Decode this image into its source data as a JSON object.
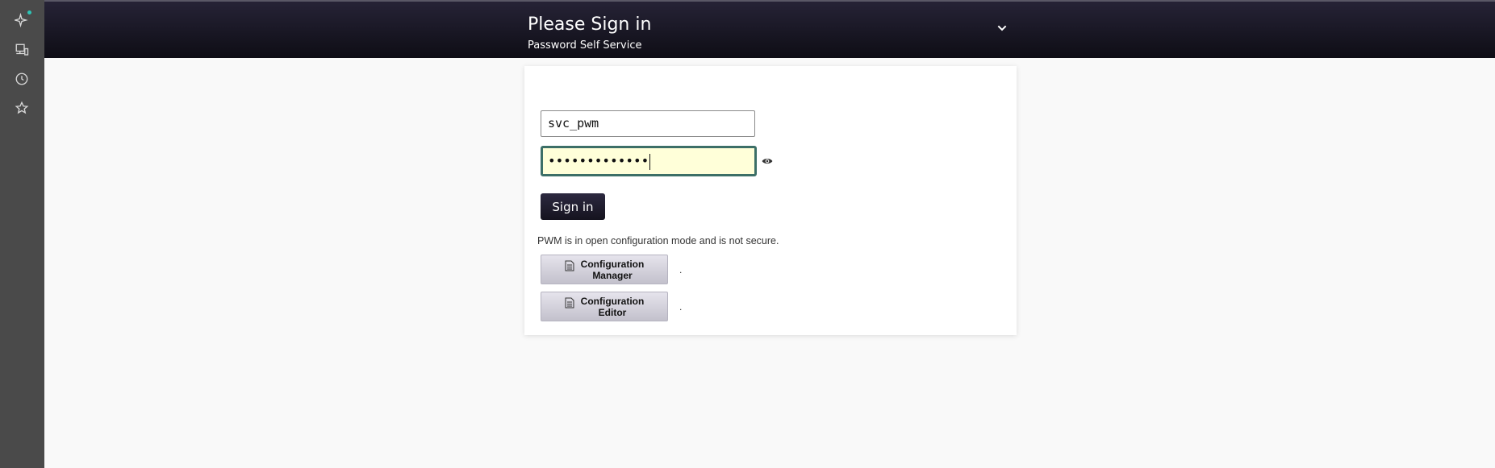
{
  "sidebar": {
    "icons": [
      "sparkle-icon",
      "device-icon",
      "history-icon",
      "star-icon"
    ],
    "badge_color": "#2ec4b6"
  },
  "header": {
    "title": "Please Sign in",
    "subtitle": "Password Self Service",
    "menu_icon": "chevron-down-icon"
  },
  "login": {
    "username_value": "svc_pwm",
    "password_masked": "•••••••••••••",
    "show_password_icon": "eye-icon",
    "signin_label": "Sign in"
  },
  "notice": {
    "text": "PWM is in open configuration mode and is not secure."
  },
  "config_buttons": [
    {
      "line1": "Configuration",
      "line2": "Manager",
      "icon": "document-icon",
      "suffix": "."
    },
    {
      "line1": "Configuration",
      "line2": "Editor",
      "icon": "document-icon",
      "suffix": "."
    }
  ],
  "colors": {
    "header_bg": "#16141f",
    "sidebar_bg": "#4a4a4a",
    "focus_border": "#3c6f67",
    "focus_bg": "#ffffd9"
  }
}
